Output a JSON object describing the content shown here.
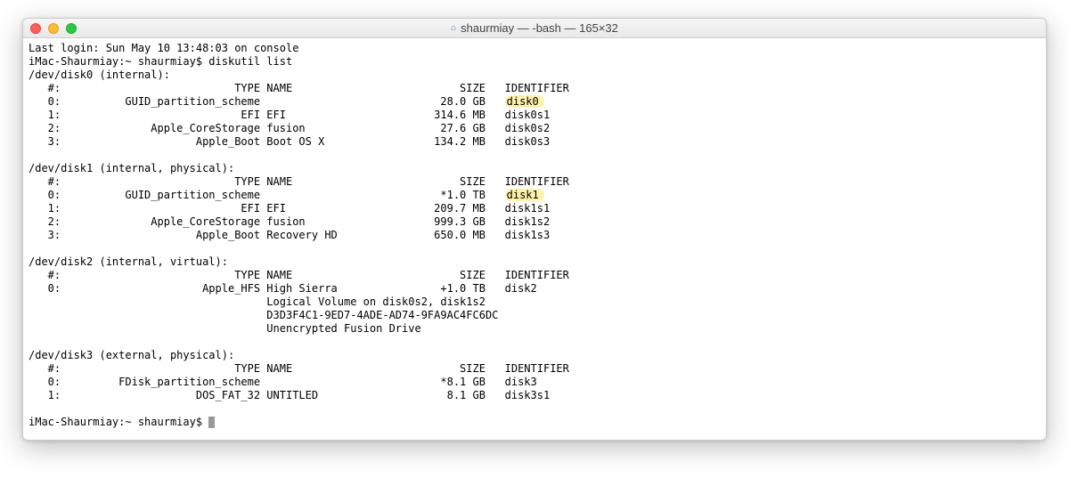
{
  "window": {
    "title": "shaurmiay — -bash — 165×32"
  },
  "session": {
    "last_login": "Last login: Sun May 10 13:48:03 on console",
    "prompt": "iMac-Shaurmiay:~ shaurmiay$ ",
    "command": "diskutil list",
    "cursor_prompt": "iMac-Shaurmiay:~ shaurmiay$ "
  },
  "disks": [
    {
      "header": "/dev/disk0 (internal):",
      "cols": {
        "num": "#:",
        "type": "TYPE",
        "name": "NAME",
        "size": "SIZE",
        "id": "IDENTIFIER"
      },
      "rows": [
        {
          "num": "0:",
          "type": "GUID_partition_scheme",
          "name": "",
          "size": "28.0 GB",
          "id": "disk0",
          "hl": true
        },
        {
          "num": "1:",
          "type": "EFI",
          "name": "EFI",
          "size": "314.6 MB",
          "id": "disk0s1"
        },
        {
          "num": "2:",
          "type": "Apple_CoreStorage",
          "name": "fusion",
          "size": "27.6 GB",
          "id": "disk0s2"
        },
        {
          "num": "3:",
          "type": "Apple_Boot",
          "name": "Boot OS X",
          "size": "134.2 MB",
          "id": "disk0s3"
        }
      ]
    },
    {
      "header": "/dev/disk1 (internal, physical):",
      "cols": {
        "num": "#:",
        "type": "TYPE",
        "name": "NAME",
        "size": "SIZE",
        "id": "IDENTIFIER"
      },
      "rows": [
        {
          "num": "0:",
          "type": "GUID_partition_scheme",
          "name": "",
          "size": "*1.0 TB",
          "id": "disk1",
          "hl": true
        },
        {
          "num": "1:",
          "type": "EFI",
          "name": "EFI",
          "size": "209.7 MB",
          "id": "disk1s1"
        },
        {
          "num": "2:",
          "type": "Apple_CoreStorage",
          "name": "fusion",
          "size": "999.3 GB",
          "id": "disk1s2"
        },
        {
          "num": "3:",
          "type": "Apple_Boot",
          "name": "Recovery HD",
          "size": "650.0 MB",
          "id": "disk1s3"
        }
      ]
    },
    {
      "header": "/dev/disk2 (internal, virtual):",
      "cols": {
        "num": "#:",
        "type": "TYPE",
        "name": "NAME",
        "size": "SIZE",
        "id": "IDENTIFIER"
      },
      "rows": [
        {
          "num": "0:",
          "type": "Apple_HFS",
          "name": "High Sierra",
          "size": "+1.0 TB",
          "id": "disk2"
        }
      ],
      "extra": [
        "Logical Volume on disk0s2, disk1s2",
        "D3D3F4C1-9ED7-4ADE-AD74-9FA9AC4FC6DC",
        "Unencrypted Fusion Drive"
      ]
    },
    {
      "header": "/dev/disk3 (external, physical):",
      "cols": {
        "num": "#:",
        "type": "TYPE",
        "name": "NAME",
        "size": "SIZE",
        "id": "IDENTIFIER"
      },
      "rows": [
        {
          "num": "0:",
          "type": "FDisk_partition_scheme",
          "name": "",
          "size": "*8.1 GB",
          "id": "disk3"
        },
        {
          "num": "1:",
          "type": "DOS_FAT_32",
          "name": "UNTITLED",
          "size": "8.1 GB",
          "id": "disk3s1"
        }
      ]
    }
  ]
}
